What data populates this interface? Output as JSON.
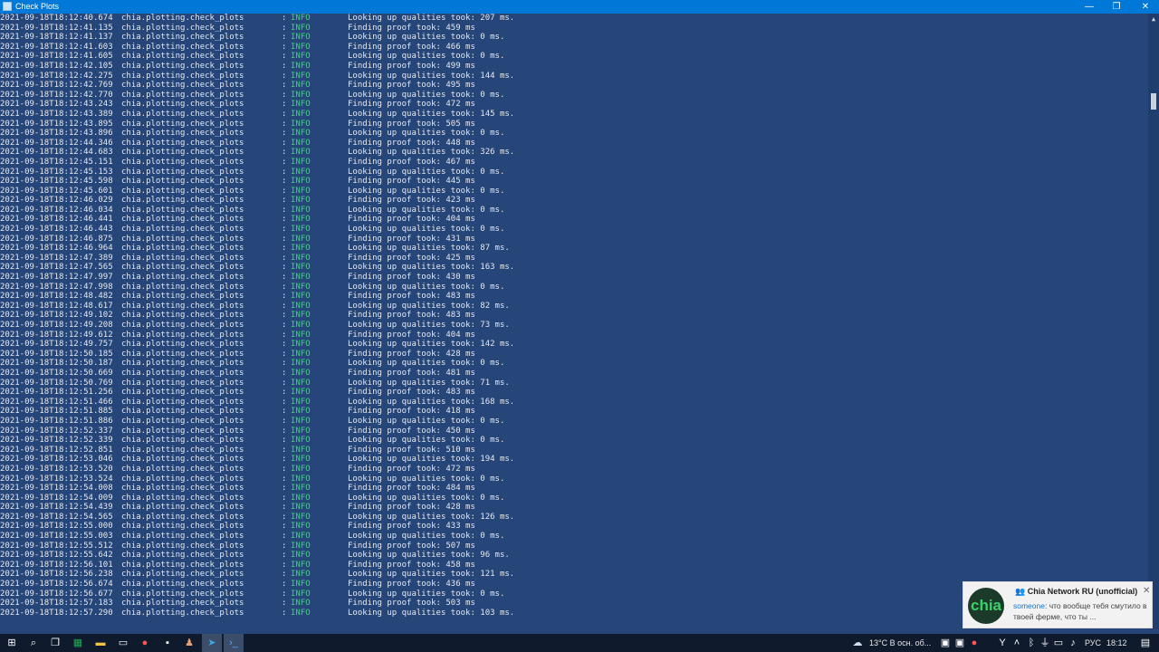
{
  "window": {
    "title": "Check Plots",
    "min": "—",
    "max": "❐",
    "close": "✕"
  },
  "log": [
    [
      "2021-09-18T18:12:40.674",
      "chia.plotting.check_plots",
      ":",
      "INFO",
      "Looking up qualities took: 207 ms."
    ],
    [
      "2021-09-18T18:12:41.135",
      "chia.plotting.check_plots",
      ":",
      "INFO",
      "Finding proof took: 459 ms"
    ],
    [
      "2021-09-18T18:12:41.137",
      "chia.plotting.check_plots",
      ":",
      "INFO",
      "Looking up qualities took: 0 ms."
    ],
    [
      "2021-09-18T18:12:41.603",
      "chia.plotting.check_plots",
      ":",
      "INFO",
      "Finding proof took: 466 ms"
    ],
    [
      "2021-09-18T18:12:41.605",
      "chia.plotting.check_plots",
      ":",
      "INFO",
      "Looking up qualities took: 0 ms."
    ],
    [
      "2021-09-18T18:12:42.105",
      "chia.plotting.check_plots",
      ":",
      "INFO",
      "Finding proof took: 499 ms"
    ],
    [
      "2021-09-18T18:12:42.275",
      "chia.plotting.check_plots",
      ":",
      "INFO",
      "Looking up qualities took: 144 ms."
    ],
    [
      "2021-09-18T18:12:42.769",
      "chia.plotting.check_plots",
      ":",
      "INFO",
      "Finding proof took: 495 ms"
    ],
    [
      "2021-09-18T18:12:42.770",
      "chia.plotting.check_plots",
      ":",
      "INFO",
      "Looking up qualities took: 0 ms."
    ],
    [
      "2021-09-18T18:12:43.243",
      "chia.plotting.check_plots",
      ":",
      "INFO",
      "Finding proof took: 472 ms"
    ],
    [
      "2021-09-18T18:12:43.389",
      "chia.plotting.check_plots",
      ":",
      "INFO",
      "Looking up qualities took: 145 ms."
    ],
    [
      "2021-09-18T18:12:43.895",
      "chia.plotting.check_plots",
      ":",
      "INFO",
      "Finding proof took: 505 ms"
    ],
    [
      "2021-09-18T18:12:43.896",
      "chia.plotting.check_plots",
      ":",
      "INFO",
      "Looking up qualities took: 0 ms."
    ],
    [
      "2021-09-18T18:12:44.346",
      "chia.plotting.check_plots",
      ":",
      "INFO",
      "Finding proof took: 448 ms"
    ],
    [
      "2021-09-18T18:12:44.683",
      "chia.plotting.check_plots",
      ":",
      "INFO",
      "Looking up qualities took: 326 ms."
    ],
    [
      "2021-09-18T18:12:45.151",
      "chia.plotting.check_plots",
      ":",
      "INFO",
      "Finding proof took: 467 ms"
    ],
    [
      "2021-09-18T18:12:45.153",
      "chia.plotting.check_plots",
      ":",
      "INFO",
      "Looking up qualities took: 0 ms."
    ],
    [
      "2021-09-18T18:12:45.598",
      "chia.plotting.check_plots",
      ":",
      "INFO",
      "Finding proof took: 445 ms"
    ],
    [
      "2021-09-18T18:12:45.601",
      "chia.plotting.check_plots",
      ":",
      "INFO",
      "Looking up qualities took: 0 ms."
    ],
    [
      "2021-09-18T18:12:46.029",
      "chia.plotting.check_plots",
      ":",
      "INFO",
      "Finding proof took: 423 ms"
    ],
    [
      "2021-09-18T18:12:46.034",
      "chia.plotting.check_plots",
      ":",
      "INFO",
      "Looking up qualities took: 0 ms."
    ],
    [
      "2021-09-18T18:12:46.441",
      "chia.plotting.check_plots",
      ":",
      "INFO",
      "Finding proof took: 404 ms"
    ],
    [
      "2021-09-18T18:12:46.443",
      "chia.plotting.check_plots",
      ":",
      "INFO",
      "Looking up qualities took: 0 ms."
    ],
    [
      "2021-09-18T18:12:46.875",
      "chia.plotting.check_plots",
      ":",
      "INFO",
      "Finding proof took: 431 ms"
    ],
    [
      "2021-09-18T18:12:46.964",
      "chia.plotting.check_plots",
      ":",
      "INFO",
      "Looking up qualities took: 87 ms."
    ],
    [
      "2021-09-18T18:12:47.389",
      "chia.plotting.check_plots",
      ":",
      "INFO",
      "Finding proof took: 425 ms"
    ],
    [
      "2021-09-18T18:12:47.565",
      "chia.plotting.check_plots",
      ":",
      "INFO",
      "Looking up qualities took: 163 ms."
    ],
    [
      "2021-09-18T18:12:47.997",
      "chia.plotting.check_plots",
      ":",
      "INFO",
      "Finding proof took: 430 ms"
    ],
    [
      "2021-09-18T18:12:47.998",
      "chia.plotting.check_plots",
      ":",
      "INFO",
      "Looking up qualities took: 0 ms."
    ],
    [
      "2021-09-18T18:12:48.482",
      "chia.plotting.check_plots",
      ":",
      "INFO",
      "Finding proof took: 483 ms"
    ],
    [
      "2021-09-18T18:12:48.617",
      "chia.plotting.check_plots",
      ":",
      "INFO",
      "Looking up qualities took: 82 ms."
    ],
    [
      "2021-09-18T18:12:49.102",
      "chia.plotting.check_plots",
      ":",
      "INFO",
      "Finding proof took: 483 ms"
    ],
    [
      "2021-09-18T18:12:49.208",
      "chia.plotting.check_plots",
      ":",
      "INFO",
      "Looking up qualities took: 73 ms."
    ],
    [
      "2021-09-18T18:12:49.612",
      "chia.plotting.check_plots",
      ":",
      "INFO",
      "Finding proof took: 404 ms"
    ],
    [
      "2021-09-18T18:12:49.757",
      "chia.plotting.check_plots",
      ":",
      "INFO",
      "Looking up qualities took: 142 ms."
    ],
    [
      "2021-09-18T18:12:50.185",
      "chia.plotting.check_plots",
      ":",
      "INFO",
      "Finding proof took: 428 ms"
    ],
    [
      "2021-09-18T18:12:50.187",
      "chia.plotting.check_plots",
      ":",
      "INFO",
      "Looking up qualities took: 0 ms."
    ],
    [
      "2021-09-18T18:12:50.669",
      "chia.plotting.check_plots",
      ":",
      "INFO",
      "Finding proof took: 481 ms"
    ],
    [
      "2021-09-18T18:12:50.769",
      "chia.plotting.check_plots",
      ":",
      "INFO",
      "Looking up qualities took: 71 ms."
    ],
    [
      "2021-09-18T18:12:51.256",
      "chia.plotting.check_plots",
      ":",
      "INFO",
      "Finding proof took: 483 ms"
    ],
    [
      "2021-09-18T18:12:51.466",
      "chia.plotting.check_plots",
      ":",
      "INFO",
      "Looking up qualities took: 168 ms."
    ],
    [
      "2021-09-18T18:12:51.885",
      "chia.plotting.check_plots",
      ":",
      "INFO",
      "Finding proof took: 418 ms"
    ],
    [
      "2021-09-18T18:12:51.886",
      "chia.plotting.check_plots",
      ":",
      "INFO",
      "Looking up qualities took: 0 ms."
    ],
    [
      "2021-09-18T18:12:52.337",
      "chia.plotting.check_plots",
      ":",
      "INFO",
      "Finding proof took: 450 ms"
    ],
    [
      "2021-09-18T18:12:52.339",
      "chia.plotting.check_plots",
      ":",
      "INFO",
      "Looking up qualities took: 0 ms."
    ],
    [
      "2021-09-18T18:12:52.851",
      "chia.plotting.check_plots",
      ":",
      "INFO",
      "Finding proof took: 510 ms"
    ],
    [
      "2021-09-18T18:12:53.046",
      "chia.plotting.check_plots",
      ":",
      "INFO",
      "Looking up qualities took: 194 ms."
    ],
    [
      "2021-09-18T18:12:53.520",
      "chia.plotting.check_plots",
      ":",
      "INFO",
      "Finding proof took: 472 ms"
    ],
    [
      "2021-09-18T18:12:53.524",
      "chia.plotting.check_plots",
      ":",
      "INFO",
      "Looking up qualities took: 0 ms."
    ],
    [
      "2021-09-18T18:12:54.008",
      "chia.plotting.check_plots",
      ":",
      "INFO",
      "Finding proof took: 484 ms"
    ],
    [
      "2021-09-18T18:12:54.009",
      "chia.plotting.check_plots",
      ":",
      "INFO",
      "Looking up qualities took: 0 ms."
    ],
    [
      "2021-09-18T18:12:54.439",
      "chia.plotting.check_plots",
      ":",
      "INFO",
      "Finding proof took: 428 ms"
    ],
    [
      "2021-09-18T18:12:54.565",
      "chia.plotting.check_plots",
      ":",
      "INFO",
      "Looking up qualities took: 126 ms."
    ],
    [
      "2021-09-18T18:12:55.000",
      "chia.plotting.check_plots",
      ":",
      "INFO",
      "Finding proof took: 433 ms"
    ],
    [
      "2021-09-18T18:12:55.003",
      "chia.plotting.check_plots",
      ":",
      "INFO",
      "Looking up qualities took: 0 ms."
    ],
    [
      "2021-09-18T18:12:55.512",
      "chia.plotting.check_plots",
      ":",
      "INFO",
      "Finding proof took: 507 ms"
    ],
    [
      "2021-09-18T18:12:55.642",
      "chia.plotting.check_plots",
      ":",
      "INFO",
      "Looking up qualities took: 96 ms."
    ],
    [
      "2021-09-18T18:12:56.101",
      "chia.plotting.check_plots",
      ":",
      "INFO",
      "Finding proof took: 458 ms"
    ],
    [
      "2021-09-18T18:12:56.238",
      "chia.plotting.check_plots",
      ":",
      "INFO",
      "Looking up qualities took: 121 ms."
    ],
    [
      "2021-09-18T18:12:56.674",
      "chia.plotting.check_plots",
      ":",
      "INFO",
      "Finding proof took: 436 ms"
    ],
    [
      "2021-09-18T18:12:56.677",
      "chia.plotting.check_plots",
      ":",
      "INFO",
      "Looking up qualities took: 0 ms."
    ],
    [
      "2021-09-18T18:12:57.183",
      "chia.plotting.check_plots",
      ":",
      "INFO",
      "Finding proof took: 503 ms"
    ],
    [
      "2021-09-18T18:12:57.290",
      "chia.plotting.check_plots",
      ":",
      "INFO",
      "Looking up qualities took: 103 ms."
    ]
  ],
  "notification": {
    "title": "Chia Network RU (unofficial)",
    "logo_text": "chia",
    "sender": "someone",
    "message": ": что вообще тебя смутило в твоей ферме, что ты ...",
    "close": "✕"
  },
  "taskbar": {
    "weather": "13°C  В осн. об...",
    "lang": "РУС",
    "time": "18:12"
  },
  "icons": {
    "start": "windows-logo-icon",
    "search": "search-icon",
    "task_view": "task-view-icon"
  },
  "colors": {
    "console_bg": "#26467a",
    "info_green": "#3fd17a",
    "titlebar": "#0078d7"
  }
}
